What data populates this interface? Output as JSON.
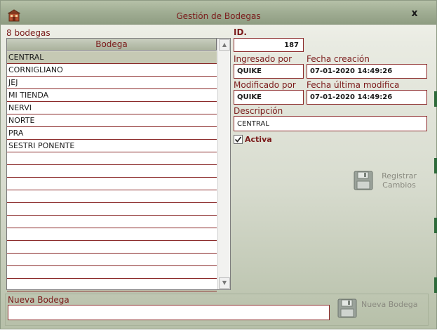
{
  "window": {
    "title": "Gestión de Bodegas",
    "close_symbol": "x",
    "app_icon": "store-icon"
  },
  "list": {
    "count_label": "8 bodegas",
    "column_header": "Bodega",
    "items": [
      "CENTRAL",
      "CORNIGLIANO",
      "JEJ",
      "MI TIENDA",
      "NERVI",
      "NORTE",
      "PRA",
      "SESTRI PONENTE"
    ],
    "selected": "CENTRAL",
    "empty_rows": 11
  },
  "details": {
    "id_label": "ID.",
    "id_value": "187",
    "ingresado_label": "Ingresado por",
    "ingresado_value": "QUIKE",
    "fecha_creacion_label": "Fecha creación",
    "fecha_creacion_value": "07-01-2020 14:49:26",
    "modificado_label": "Modificado por",
    "modificado_value": "QUIKE",
    "fecha_modifica_label": "Fecha última modifica",
    "fecha_modifica_value": "07-01-2020 14:49:26",
    "descripcion_label": "Descripción",
    "descripcion_value": "CENTRAL",
    "activa_label": "Activa",
    "activa_checked": true
  },
  "actions": {
    "save_label": "Registrar\nCambios",
    "save_icon": "floppy-disk-icon",
    "new_label": "Nueva Bodega",
    "new_icon": "floppy-disk-icon"
  },
  "new_bodega": {
    "label": "Nueva Bodega",
    "value": ""
  },
  "colors": {
    "label_text": "#7a1a1a",
    "field_border": "#8b2a2a",
    "selected_row": "#c6c9b4",
    "titlebar": "#a0ad93"
  }
}
